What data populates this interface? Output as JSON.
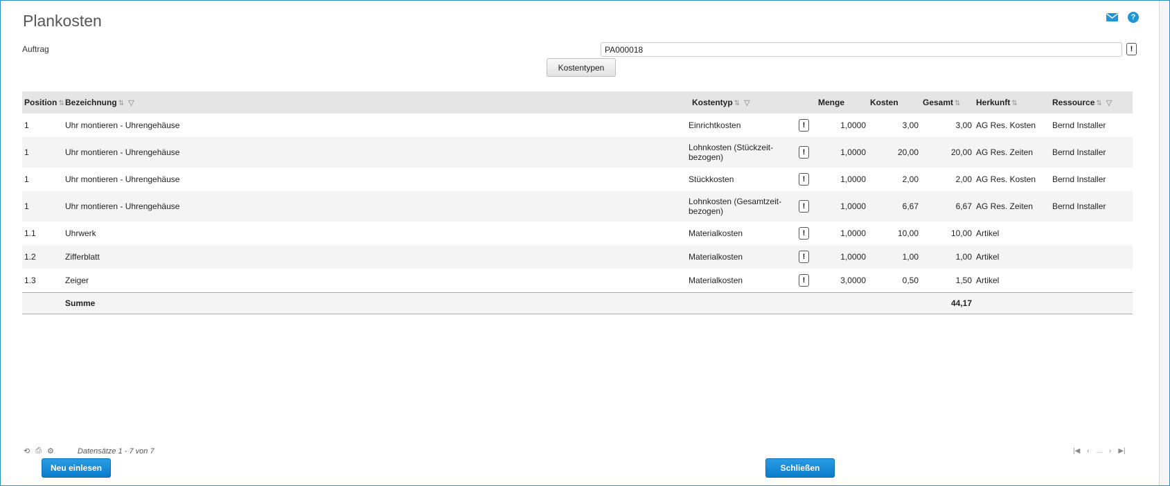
{
  "page": {
    "title": "Plankosten"
  },
  "order": {
    "label": "Auftrag",
    "value": "PA000018"
  },
  "kostentypen_label": "Kostentypen",
  "table": {
    "headers": {
      "position": "Position",
      "bezeichnung": "Bezeichnung",
      "kostentyp": "Kostentyp",
      "menge": "Menge",
      "kosten": "Kosten",
      "gesamt": "Gesamt",
      "herkunft": "Herkunft",
      "ressource": "Ressource"
    },
    "rows": [
      {
        "position": "1",
        "bezeichnung": "Uhr montieren - Uhrengehäuse",
        "kostentyp": "Einrichtkosten",
        "menge": "1,0000",
        "kosten": "3,00",
        "gesamt": "3,00",
        "herkunft": "AG Res. Kosten",
        "ressource": "Bernd Installer"
      },
      {
        "position": "1",
        "bezeichnung": "Uhr montieren - Uhrengehäuse",
        "kostentyp": "Lohnkosten (Stückzeit-bezogen)",
        "menge": "1,0000",
        "kosten": "20,00",
        "gesamt": "20,00",
        "herkunft": "AG Res. Zeiten",
        "ressource": "Bernd Installer"
      },
      {
        "position": "1",
        "bezeichnung": "Uhr montieren - Uhrengehäuse",
        "kostentyp": "Stückkosten",
        "menge": "1,0000",
        "kosten": "2,00",
        "gesamt": "2,00",
        "herkunft": "AG Res. Kosten",
        "ressource": "Bernd Installer"
      },
      {
        "position": "1",
        "bezeichnung": "Uhr montieren - Uhrengehäuse",
        "kostentyp": "Lohnkosten (Gesamtzeit-bezogen)",
        "menge": "1,0000",
        "kosten": "6,67",
        "gesamt": "6,67",
        "herkunft": "AG Res. Zeiten",
        "ressource": "Bernd Installer"
      },
      {
        "position": "1.1",
        "bezeichnung": "Uhrwerk",
        "kostentyp": "Materialkosten",
        "menge": "1,0000",
        "kosten": "10,00",
        "gesamt": "10,00",
        "herkunft": "Artikel",
        "ressource": ""
      },
      {
        "position": "1.2",
        "bezeichnung": "Zifferblatt",
        "kostentyp": "Materialkosten",
        "menge": "1,0000",
        "kosten": "1,00",
        "gesamt": "1,00",
        "herkunft": "Artikel",
        "ressource": ""
      },
      {
        "position": "1.3",
        "bezeichnung": "Zeiger",
        "kostentyp": "Materialkosten",
        "menge": "3,0000",
        "kosten": "0,50",
        "gesamt": "1,50",
        "herkunft": "Artikel",
        "ressource": ""
      }
    ],
    "footer": {
      "label": "Summe",
      "total": "44,17"
    }
  },
  "pager": {
    "status": "Datensätze 1 - 7 von 7",
    "ellipsis": "..."
  },
  "buttons": {
    "reload": "Neu einlesen",
    "close": "Schließen"
  },
  "icons": {
    "mail": "mail-icon",
    "help": "help-icon",
    "reload": "refresh-icon",
    "print": "print-icon",
    "settings": "settings-icon",
    "export": "export-icon"
  },
  "colors": {
    "accent": "#1e96d8",
    "button": "#0b7ccb",
    "header_bg": "#e5e5e5"
  }
}
